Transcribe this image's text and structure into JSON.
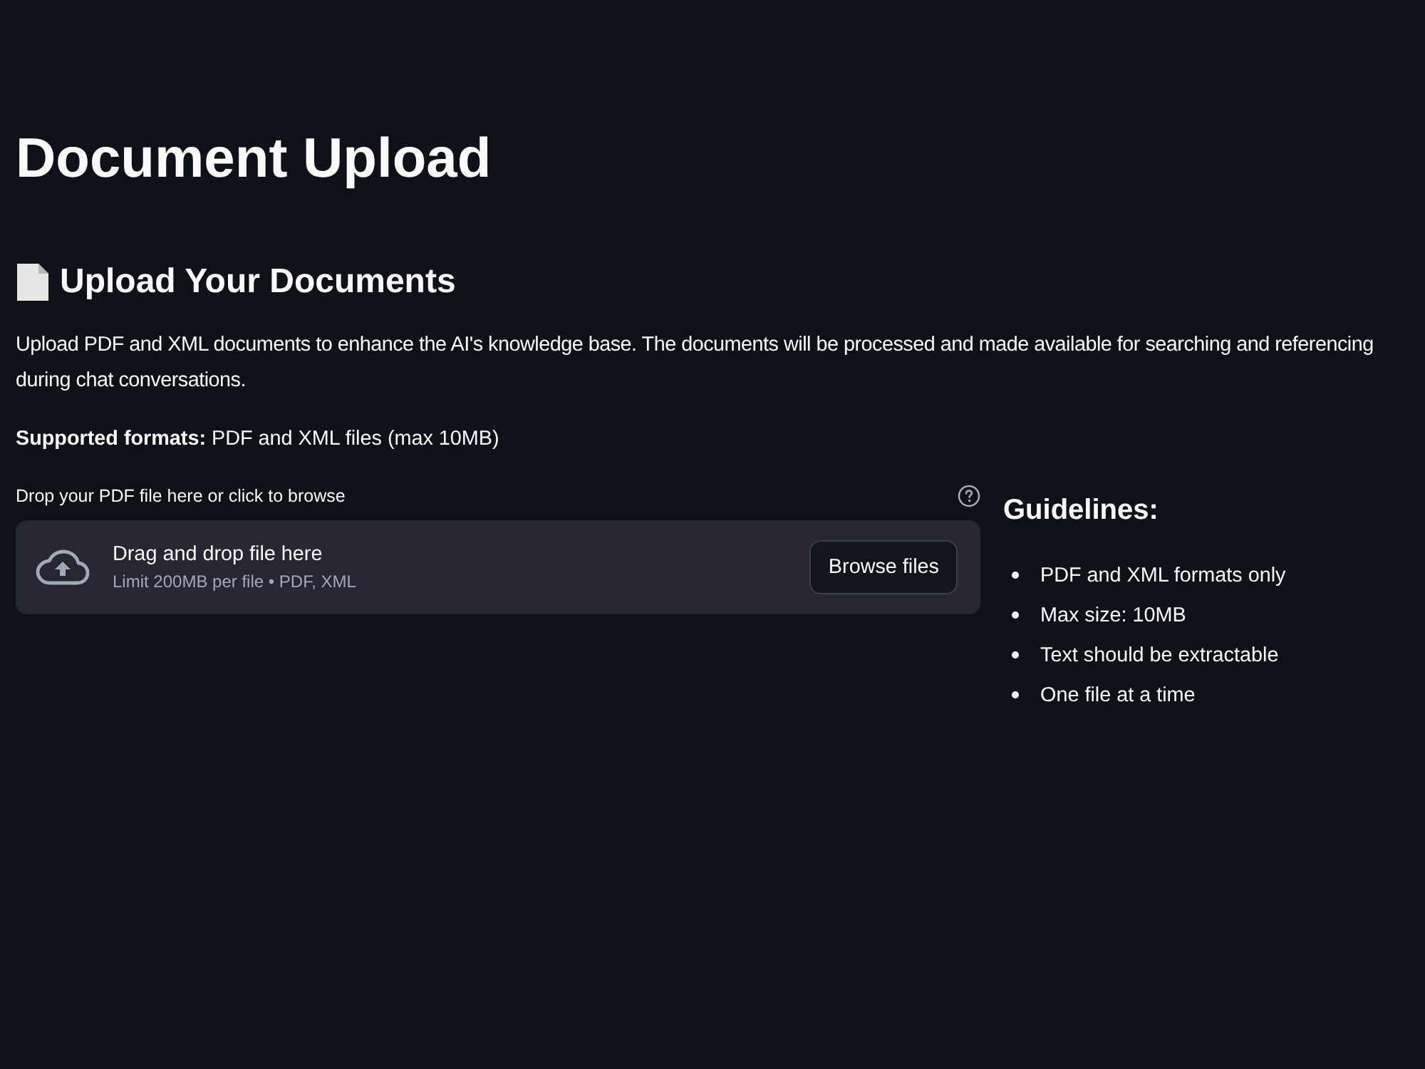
{
  "page": {
    "title": "Document Upload"
  },
  "section": {
    "heading": "Upload Your Documents",
    "description": "Upload PDF and XML documents to enhance the AI's knowledge base. The documents will be processed and made available for searching and referencing during chat conversations.",
    "supported": "**Supported formats:** PDF and XML files (max 10MB)"
  },
  "uploader": {
    "label": "Drop your PDF file here or click to browse",
    "prompt": "Drag and drop file here",
    "limit": "Limit 200MB per file • PDF, XML",
    "button": "Browse files"
  },
  "guidelines": {
    "heading": "Guidelines:",
    "items": [
      "PDF and XML formats only",
      "Max size: 10MB",
      "Text should be extractable",
      "One file at a time"
    ]
  }
}
